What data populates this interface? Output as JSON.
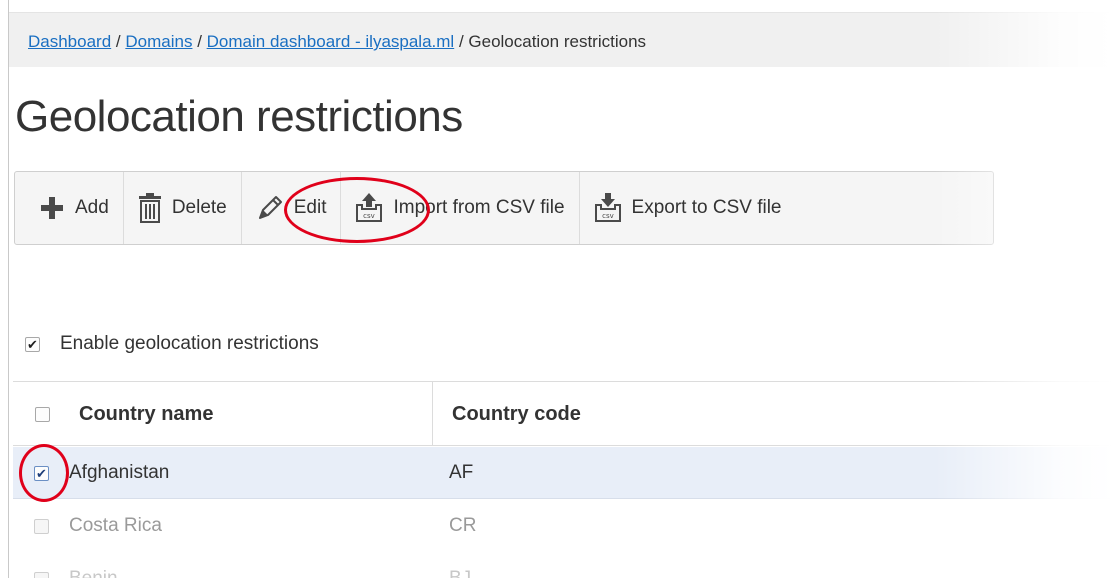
{
  "breadcrumb": {
    "items": [
      {
        "label": "Dashboard",
        "link": true
      },
      {
        "label": "Domains",
        "link": true
      },
      {
        "label": "Domain dashboard - ilyaspala.ml",
        "link": true
      },
      {
        "label": "Geolocation restrictions",
        "link": false
      }
    ],
    "separator": "/"
  },
  "page_title": "Geolocation restrictions",
  "toolbar": {
    "add_label": "Add",
    "delete_label": "Delete",
    "edit_label": "Edit",
    "import_label": "Import from CSV file",
    "export_label": "Export to CSV file",
    "icons": [
      "plus-icon",
      "trash-icon",
      "pencil-icon",
      "csv-import-icon",
      "csv-export-icon"
    ]
  },
  "enable_option": {
    "label": "Enable geolocation restrictions",
    "checked": true
  },
  "table": {
    "columns": [
      "Country name",
      "Country code"
    ],
    "rows": [
      {
        "name": "Afghanistan",
        "code": "AF",
        "checked": true
      },
      {
        "name": "Costa Rica",
        "code": "CR",
        "checked": false
      },
      {
        "name": "Benin",
        "code": "BJ",
        "checked": false
      }
    ]
  },
  "colors": {
    "link": "#1a6fc2",
    "highlight": "#e0001a",
    "selected_row": "#e8eef8"
  }
}
